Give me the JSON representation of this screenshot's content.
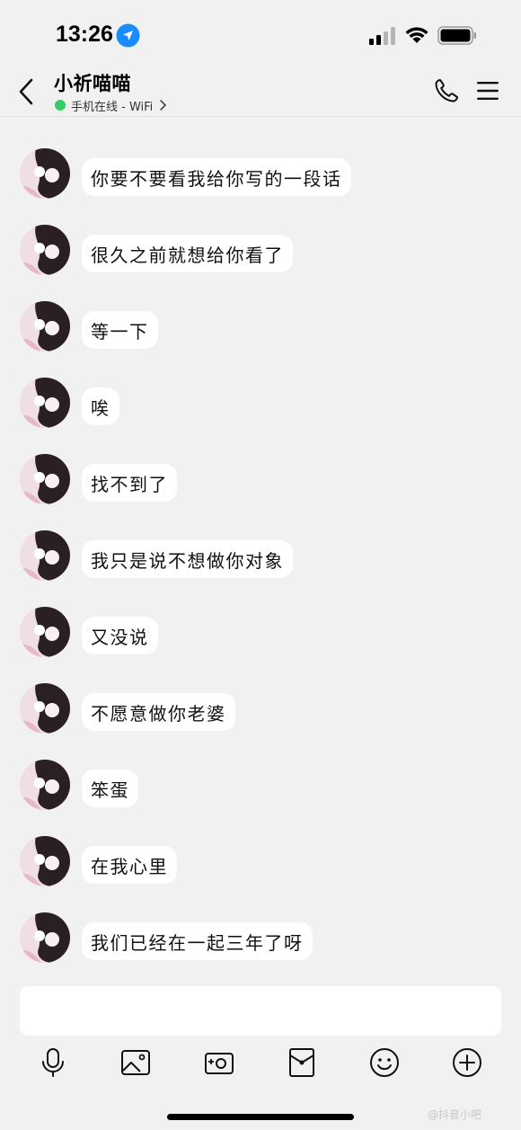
{
  "status_bar": {
    "time": "13:26",
    "icons": [
      "location-arrow-icon",
      "cellular-signal-icon",
      "wifi-icon",
      "battery-icon"
    ]
  },
  "header": {
    "contact_name": "小祈喵喵",
    "online_status": "手机在线 - WiFi",
    "status_color": "#33cc66",
    "icons": [
      "back-chevron-icon",
      "phone-call-icon",
      "menu-icon"
    ]
  },
  "messages": [
    {
      "sender": "contact",
      "text": "你要不要看我给你写的一段话"
    },
    {
      "sender": "contact",
      "text": "很久之前就想给你看了"
    },
    {
      "sender": "contact",
      "text": "等一下"
    },
    {
      "sender": "contact",
      "text": "唉"
    },
    {
      "sender": "contact",
      "text": "找不到了"
    },
    {
      "sender": "contact",
      "text": "我只是说不想做你对象"
    },
    {
      "sender": "contact",
      "text": "又没说"
    },
    {
      "sender": "contact",
      "text": "不愿意做你老婆"
    },
    {
      "sender": "contact",
      "text": "笨蛋"
    },
    {
      "sender": "contact",
      "text": "在我心里"
    },
    {
      "sender": "contact",
      "text": "我们已经在一起三年了呀"
    }
  ],
  "input": {
    "value": "",
    "placeholder": ""
  },
  "toolbar": [
    "microphone-icon",
    "image-icon",
    "camera-icon",
    "red-packet-icon",
    "emoji-icon",
    "plus-icon"
  ],
  "watermark": "@抖音小吧",
  "colors": {
    "background": "#f1f1f1",
    "bubble": "#ffffff",
    "online": "#33cc66"
  }
}
